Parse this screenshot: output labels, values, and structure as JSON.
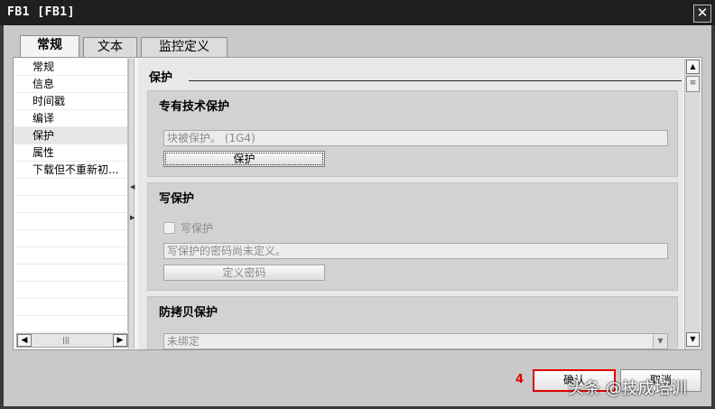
{
  "window": {
    "title": "FB1 [FB1]",
    "close_glyph": "✕"
  },
  "tabs": [
    {
      "label": "常规",
      "active": true
    },
    {
      "label": "文本",
      "active": false
    },
    {
      "label": "监控定义",
      "active": false
    }
  ],
  "nav": {
    "items": [
      {
        "label": "常规",
        "selected": false
      },
      {
        "label": "信息",
        "selected": false
      },
      {
        "label": "时间戳",
        "selected": false
      },
      {
        "label": "编译",
        "selected": false
      },
      {
        "label": "保护",
        "selected": true
      },
      {
        "label": "属性",
        "selected": false
      },
      {
        "label": "下载但不重新初...",
        "selected": false
      }
    ],
    "scroll_left_glyph": "◀",
    "scroll_right_glyph": "▶",
    "scroll_grip_glyph": "|||"
  },
  "content": {
    "section_heading": "保护",
    "know_how": {
      "title": "专有技术保护",
      "status_text": "块被保护。 (1G4)",
      "button_label": "保护"
    },
    "write_protect": {
      "title": "写保护",
      "checkbox_label": "写保护",
      "checkbox_checked": false,
      "status_text": "写保护的密码尚未定义。",
      "button_label": "定义密码"
    },
    "copy_protect": {
      "title": "防拷贝保护",
      "select_value": "未绑定"
    }
  },
  "scrollbar": {
    "up_glyph": "▲",
    "down_glyph": "▼",
    "thumb_glyph": "≡"
  },
  "footer": {
    "step_number": "4",
    "ok_label": "确认",
    "cancel_label": "取消",
    "watermark": "头条 @技成培训"
  },
  "colors": {
    "highlight": "#e00000",
    "titlebar": "#1f1f1f",
    "dialog_bg": "#c9c9c9"
  },
  "icons": {
    "close": "close-icon",
    "checkbox": "checkbox-icon",
    "dropdown": "chevron-down-icon"
  }
}
